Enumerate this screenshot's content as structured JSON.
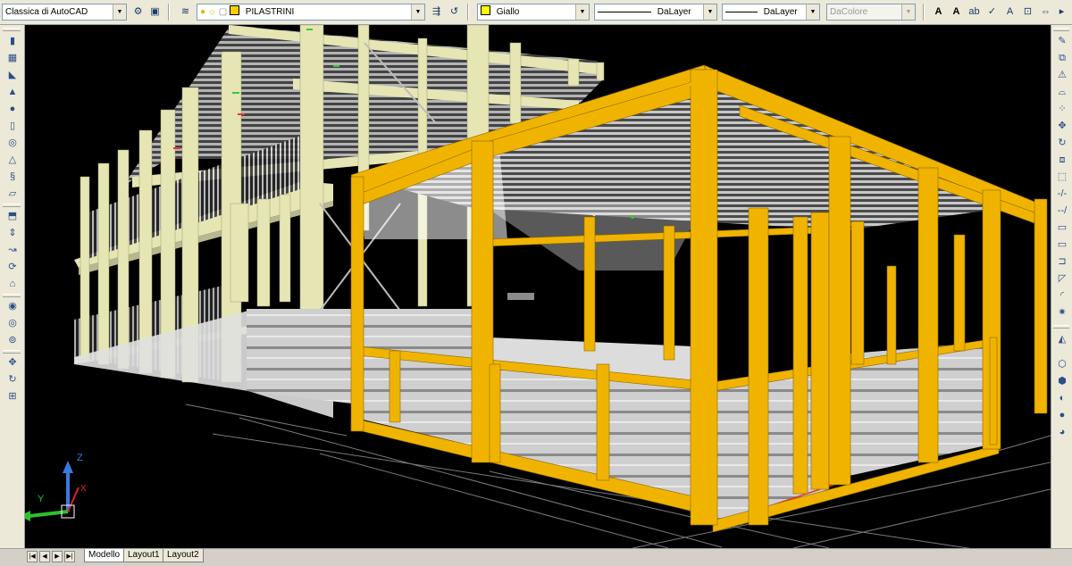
{
  "toolbar": {
    "workspace": "Classica di AutoCAD",
    "layer_name": "PILASTRINI",
    "color_value": "Giallo",
    "color_swatch": "#ffff00",
    "layer_swatch": "#ffcc00",
    "linetype_value": "DaLayer",
    "lineweight_value": "DaLayer",
    "plotstyle_value": "DaColore"
  },
  "layout_tabs": {
    "model": "Modello",
    "layout1": "Layout1",
    "layout2": "Layout2"
  },
  "ucs": {
    "z_label": "Z",
    "y_label": "Y",
    "x_label": "X"
  },
  "colors": {
    "accent_steel": "#f0b400",
    "cream_steel": "#e6e6b4",
    "cladding": "#c8c8c8",
    "viewport_bg": "#000000"
  }
}
